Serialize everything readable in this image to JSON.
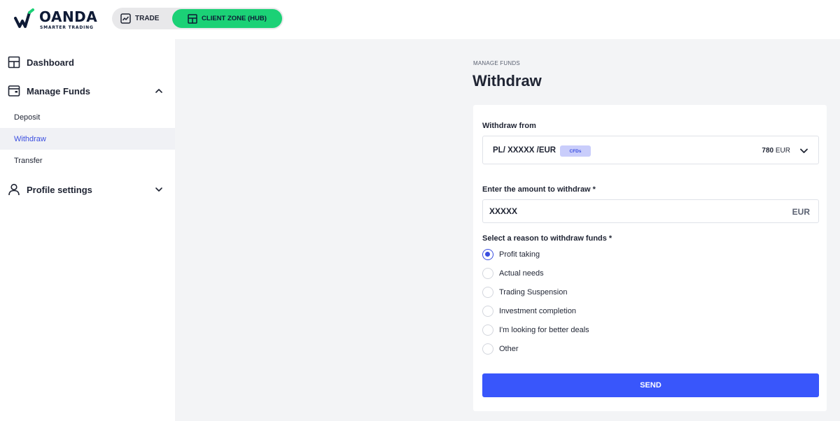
{
  "brand": {
    "name": "OANDA",
    "tagline": "SMARTER TRADING",
    "colors": {
      "green": "#1bd176",
      "navy": "#0e1a35",
      "accent": "#3956fb"
    }
  },
  "switcher": {
    "trade_label": "TRADE",
    "hub_label": "CLIENT ZONE (HUB)",
    "trade_icon": "chart-line-icon",
    "hub_icon": "layout-grid-icon"
  },
  "sidebar": {
    "dashboard": {
      "label": "Dashboard",
      "icon": "layout-grid-icon"
    },
    "manage_funds": {
      "label": "Manage Funds",
      "icon": "wallet-icon",
      "expanded": true,
      "items": [
        {
          "label": "Deposit",
          "active": false
        },
        {
          "label": "Withdraw",
          "active": true
        },
        {
          "label": "Transfer",
          "active": false
        }
      ]
    },
    "profile_settings": {
      "label": "Profile settings",
      "icon": "user-icon",
      "expanded": false
    }
  },
  "page": {
    "breadcrumb": "MANAGE FUNDS",
    "title": "Withdraw"
  },
  "form": {
    "from_label": "Withdraw from",
    "account": "PL/ XXXXX /EUR",
    "account_tag": "CFDs",
    "balance_value": "780",
    "balance_currency": "EUR",
    "amount_label": "Enter the amount to withdraw *",
    "amount_value": "XXXXX",
    "amount_currency": "EUR",
    "reason_label": "Select a reason to withdraw funds *",
    "reasons": [
      {
        "label": "Profit taking",
        "checked": true
      },
      {
        "label": "Actual needs",
        "checked": false
      },
      {
        "label": "Trading Suspension",
        "checked": false
      },
      {
        "label": "Investment completion",
        "checked": false
      },
      {
        "label": "I'm looking for better deals",
        "checked": false
      },
      {
        "label": "Other",
        "checked": false
      }
    ],
    "send_label": "SEND"
  }
}
